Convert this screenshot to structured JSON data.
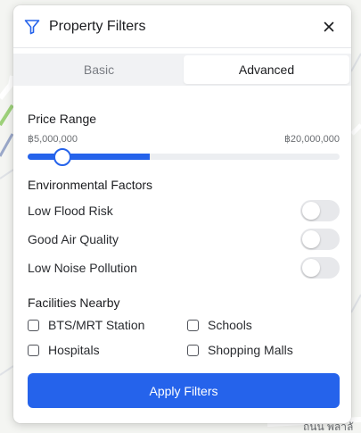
{
  "map": {
    "street_label": "ถนน พลาลั"
  },
  "panel": {
    "title": "Property Filters",
    "icons": {
      "filter": "filter-icon",
      "close": "close-icon"
    },
    "accent_color": "#2563eb"
  },
  "tabs": [
    {
      "label": "Basic",
      "active": false
    },
    {
      "label": "Advanced",
      "active": true
    }
  ],
  "price": {
    "heading": "Price Range",
    "min_label": "฿5,000,000",
    "max_label": "฿20,000,000",
    "handle_value_fraction": 0.11,
    "fill_end_fraction": 0.39
  },
  "environment": {
    "heading": "Environmental Factors",
    "items": [
      {
        "label": "Low Flood Risk",
        "on": false
      },
      {
        "label": "Good Air Quality",
        "on": false
      },
      {
        "label": "Low Noise Pollution",
        "on": false
      }
    ]
  },
  "facilities": {
    "heading": "Facilities Nearby",
    "items": [
      {
        "label": "BTS/MRT Station",
        "checked": false
      },
      {
        "label": "Schools",
        "checked": false
      },
      {
        "label": "Hospitals",
        "checked": false
      },
      {
        "label": "Shopping Malls",
        "checked": false
      }
    ]
  },
  "apply_label": "Apply Filters"
}
